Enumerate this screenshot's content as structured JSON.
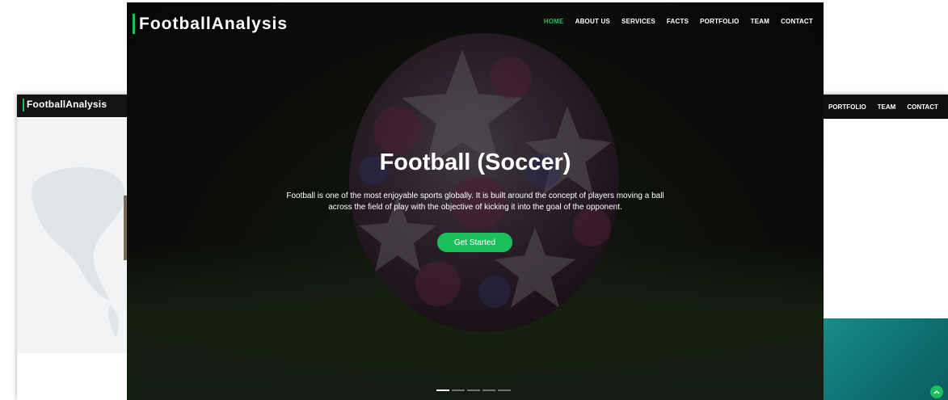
{
  "left_preview": {
    "logo": "FootballAnalysis"
  },
  "right_preview": {
    "nav": [
      "PORTFOLIO",
      "TEAM",
      "CONTACT"
    ],
    "scroll_top_icon": "chevron-up-icon"
  },
  "header": {
    "logo": "FootballAnalysis",
    "nav": [
      {
        "label": "HOME",
        "active": true
      },
      {
        "label": "ABOUT US",
        "active": false
      },
      {
        "label": "SERVICES",
        "active": false
      },
      {
        "label": "FACTS",
        "active": false
      },
      {
        "label": "PORTFOLIO",
        "active": false
      },
      {
        "label": "TEAM",
        "active": false
      },
      {
        "label": "CONTACT",
        "active": false
      }
    ]
  },
  "hero": {
    "title": "Football (Soccer)",
    "description": "Football is one of the most enjoyable sports globally. It is built around the concept of players moving a ball across the field of play with the objective of kicking it into the goal of the opponent.",
    "cta_label": "Get Started",
    "slide_count": 5,
    "active_slide": 1
  },
  "colors": {
    "accent": "#1bbf5c",
    "nav_text": "#ffffff",
    "header_bg": "#141414"
  }
}
